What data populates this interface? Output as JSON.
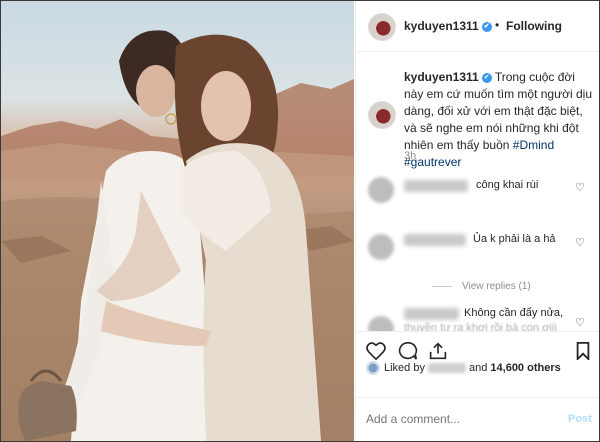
{
  "header": {
    "username": "kyduyen1311",
    "verified_icon": "✔",
    "follow_label": "Following",
    "separator": "•"
  },
  "caption": {
    "username": "kyduyen1311",
    "text": "Trong cuộc đời này em cứ muốn tìm một người dịu dàng, đối xử với em thật đặc biệt, và sẽ nghe em nói những khi đột nhiên em thấy buồn",
    "tags": "#Dmind #gautrever"
  },
  "time": "3h",
  "comments": [
    {
      "text": "công khai rùi"
    },
    {
      "text": "Ủa k phải là a hả"
    },
    {
      "text": "Không cần đẩy nửa,"
    }
  ],
  "view_replies": "View replies (1)",
  "faded_comment": "thuyền tự ra khơi rồi bà con ơiii",
  "likes": {
    "prefix": "Liked by",
    "connector": "and",
    "count": "14,600 others"
  },
  "add_comment": {
    "placeholder": "Add a comment...",
    "post_label": "Post"
  },
  "colors": {
    "link": "#003569",
    "verified": "#3897f0",
    "post": "#b2dffc",
    "muted": "#8e8e8e"
  }
}
